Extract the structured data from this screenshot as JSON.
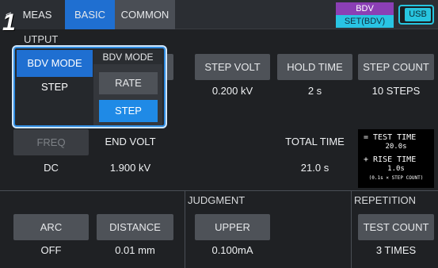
{
  "tabs": {
    "meas": "MEAS",
    "basic": "BASIC",
    "common": "COMMON"
  },
  "status": {
    "bdv": "BDV",
    "set_bdv": "SET(BDV)",
    "usb": "USB"
  },
  "step_number": "1",
  "output": {
    "title": "UTPUT",
    "bdv_mode_label": "BDV MODE",
    "bdv_mode_value": "STEP",
    "step_volt_label": "STEP VOLT",
    "step_volt_value": "0.200 kV",
    "hold_time_label": "HOLD TIME",
    "hold_time_value": "2 s",
    "step_count_label": "STEP COUNT",
    "step_count_value": "10 STEPS",
    "freq_label": "FREQ",
    "freq_value": "DC",
    "end_volt_label": "END VOLT",
    "end_volt_value": "1.900 kV",
    "total_time_label": "TOTAL TIME",
    "total_time_value": "21.0 s"
  },
  "popup": {
    "title": "BDV MODE",
    "options": [
      "RATE",
      "STEP"
    ],
    "selected": "STEP"
  },
  "infobox": {
    "line1": "= TEST TIME",
    "line2": "20.0s",
    "line3": "+ RISE TIME",
    "line4": "1.0s",
    "line5": "(0.1s × STEP COUNT)"
  },
  "bottom": {
    "arc_label": "ARC",
    "arc_value": "OFF",
    "distance_label": "DISTANCE",
    "distance_value": "0.01 mm",
    "judgment_title": "JUDGMENT",
    "upper_label": "UPPER",
    "upper_value": "0.100mA",
    "repetition_title": "REPETITION",
    "test_count_label": "TEST COUNT",
    "test_count_value": "3 TIMES"
  }
}
